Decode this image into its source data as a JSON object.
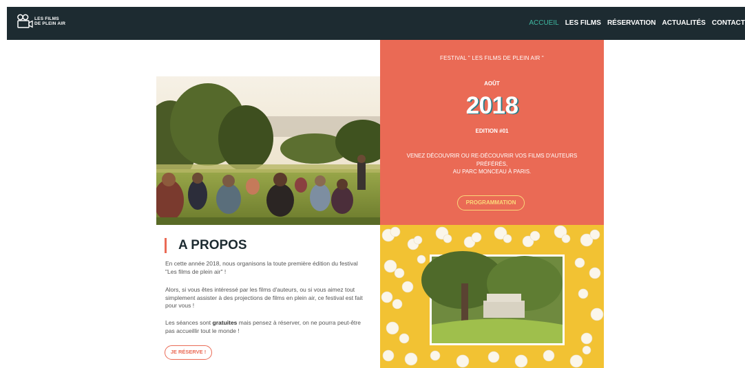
{
  "colors": {
    "navbar_bg": "#1d2b31",
    "accent_coral": "#ea6a55",
    "active_link": "#3fb8a1",
    "button_yellow": "#fbd87a",
    "popcorn_bg": "#f2c233"
  },
  "logo": {
    "icon": "film-camera-icon",
    "line1": "LES FILMS",
    "line2": "DE PLEIN AIR"
  },
  "nav": {
    "items": [
      {
        "label": "ACCUEIL",
        "active": true
      },
      {
        "label": "LES FILMS",
        "active": false
      },
      {
        "label": "RÉSERVATION",
        "active": false
      },
      {
        "label": "ACTUALITÉS",
        "active": false
      },
      {
        "label": "CONTACT",
        "active": false
      }
    ]
  },
  "festival": {
    "title": "FESTIVAL \" LES FILMS DE PLEIN AIR \"",
    "month": "AOÛT",
    "year": "2018",
    "edition": "EDITION #01",
    "description_line1": "VENEZ DÉCOUVRIR OU RE-DÉCOUVRIR VOS FILMS D'AUTEURS",
    "description_line2": "PRÉFÉRÉS,",
    "description_line3": "AU PARC MONCEAU À PARIS.",
    "button": "PROGRAMMATION"
  },
  "about": {
    "heading": "A PROPOS",
    "paragraph1": "En cette année 2018, nous organisons la toute première édition du festival \"Les films de plein air\" !",
    "paragraph2": "Alors, si vous êtes intéressé par les films d'auteurs, ou si vous aimez tout simplement assister à des projections de films en plein air, ce festival est fait pour vous !",
    "paragraph3_before": "Les séances sont ",
    "paragraph3_bold": "gratuites",
    "paragraph3_after": " mais pensez à réserver, on ne pourra peut-être pas accueillir tout le monde !",
    "button": "JE RÉSERVE !"
  }
}
